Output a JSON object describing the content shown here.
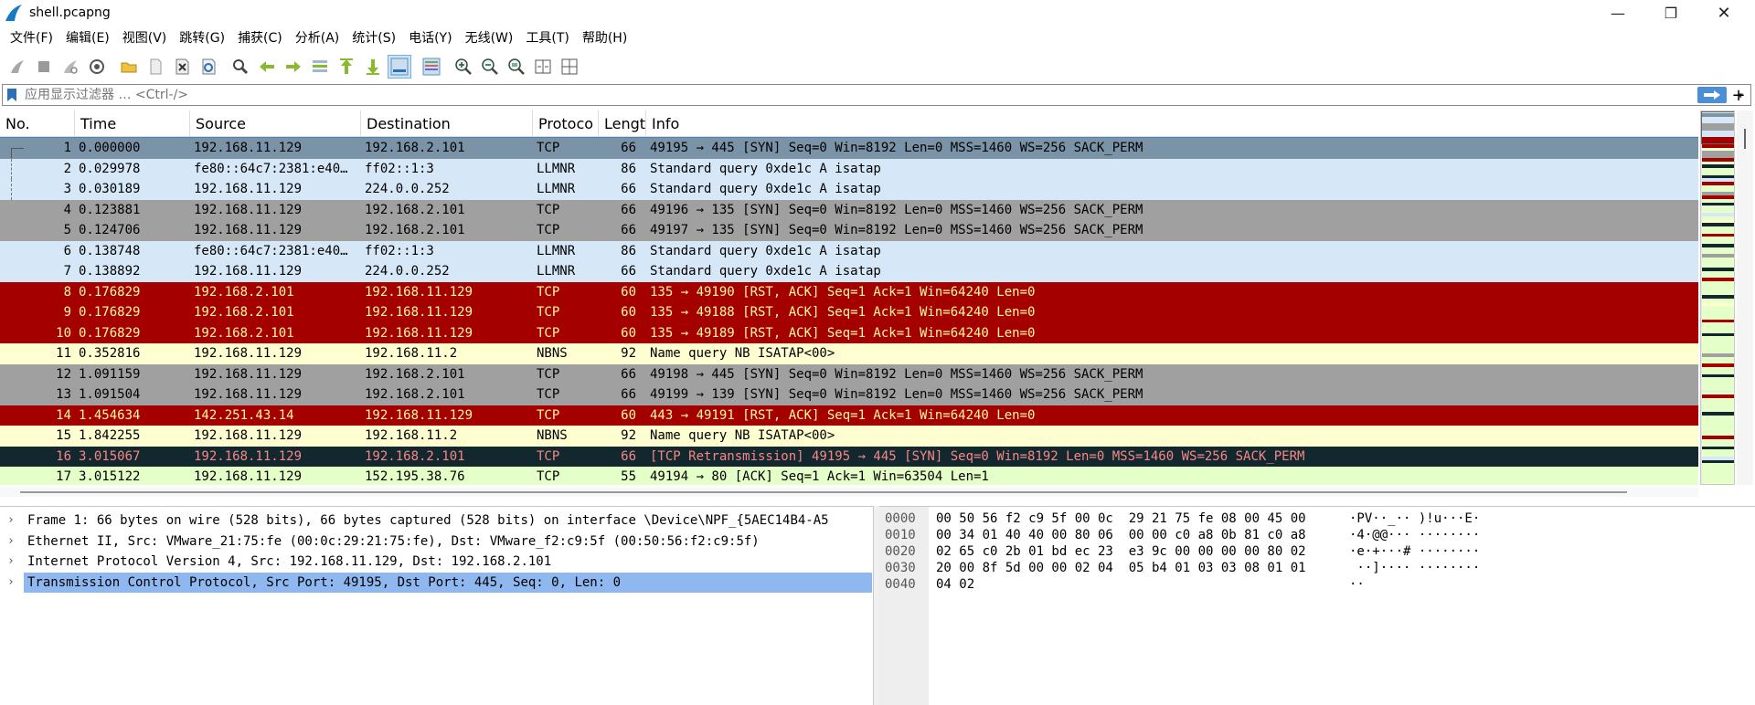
{
  "window": {
    "title": "shell.pcapng",
    "min_glyph": "—",
    "max_glyph": "❐",
    "close_glyph": "✕"
  },
  "menu": [
    "文件(F)",
    "编辑(E)",
    "视图(V)",
    "跳转(G)",
    "捕获(C)",
    "分析(A)",
    "统计(S)",
    "电话(Y)",
    "无线(W)",
    "工具(T)",
    "帮助(H)"
  ],
  "filter": {
    "placeholder": "应用显示过滤器 … <Ctrl-/>",
    "add_glyph": "+",
    "dropdown_glyph": "▾"
  },
  "columns": {
    "no": "No.",
    "time": "Time",
    "source": "Source",
    "destination": "Destination",
    "protocol": "Protoco",
    "length": "Lengt",
    "info": "Info"
  },
  "colors": {
    "selected_bg": "#7b93a7",
    "selected_fg": "#000000",
    "llmnr_bg": "#d6e8f8",
    "tcp_gray_bg": "#a0a0a0",
    "rst_bg": "#a40000",
    "rst_fg": "#fffc9c",
    "nbns_bg": "#fefed0",
    "retrans_bg": "#12272e",
    "retrans_fg": "#f78787",
    "ack_bg": "#e4ffc7",
    "accent": "#4a90d9"
  },
  "packets": [
    {
      "no": "1",
      "time": "0.000000",
      "source": "192.168.11.129",
      "destination": "192.168.2.101",
      "protocol": "TCP",
      "length": "66",
      "info": "49195 → 445 [SYN] Seq=0 Win=8192 Len=0 MSS=1460 WS=256 SACK_PERM",
      "style": "selected"
    },
    {
      "no": "2",
      "time": "0.029978",
      "source": "fe80::64c7:2381:e40…",
      "destination": "ff02::1:3",
      "protocol": "LLMNR",
      "length": "86",
      "info": "Standard query 0xde1c A isatap",
      "style": "llmnr"
    },
    {
      "no": "3",
      "time": "0.030189",
      "source": "192.168.11.129",
      "destination": "224.0.0.252",
      "protocol": "LLMNR",
      "length": "66",
      "info": "Standard query 0xde1c A isatap",
      "style": "llmnr"
    },
    {
      "no": "4",
      "time": "0.123881",
      "source": "192.168.11.129",
      "destination": "192.168.2.101",
      "protocol": "TCP",
      "length": "66",
      "info": "49196 → 135 [SYN] Seq=0 Win=8192 Len=0 MSS=1460 WS=256 SACK_PERM",
      "style": "tcpgray"
    },
    {
      "no": "5",
      "time": "0.124706",
      "source": "192.168.11.129",
      "destination": "192.168.2.101",
      "protocol": "TCP",
      "length": "66",
      "info": "49197 → 135 [SYN] Seq=0 Win=8192 Len=0 MSS=1460 WS=256 SACK_PERM",
      "style": "tcpgray"
    },
    {
      "no": "6",
      "time": "0.138748",
      "source": "fe80::64c7:2381:e40…",
      "destination": "ff02::1:3",
      "protocol": "LLMNR",
      "length": "86",
      "info": "Standard query 0xde1c A isatap",
      "style": "llmnr"
    },
    {
      "no": "7",
      "time": "0.138892",
      "source": "192.168.11.129",
      "destination": "224.0.0.252",
      "protocol": "LLMNR",
      "length": "66",
      "info": "Standard query 0xde1c A isatap",
      "style": "llmnr"
    },
    {
      "no": "8",
      "time": "0.176829",
      "source": "192.168.2.101",
      "destination": "192.168.11.129",
      "protocol": "TCP",
      "length": "60",
      "info": "135 → 49190 [RST, ACK] Seq=1 Ack=1 Win=64240 Len=0",
      "style": "rst"
    },
    {
      "no": "9",
      "time": "0.176829",
      "source": "192.168.2.101",
      "destination": "192.168.11.129",
      "protocol": "TCP",
      "length": "60",
      "info": "135 → 49188 [RST, ACK] Seq=1 Ack=1 Win=64240 Len=0",
      "style": "rst"
    },
    {
      "no": "10",
      "time": "0.176829",
      "source": "192.168.2.101",
      "destination": "192.168.11.129",
      "protocol": "TCP",
      "length": "60",
      "info": "135 → 49189 [RST, ACK] Seq=1 Ack=1 Win=64240 Len=0",
      "style": "rst"
    },
    {
      "no": "11",
      "time": "0.352816",
      "source": "192.168.11.129",
      "destination": "192.168.11.2",
      "protocol": "NBNS",
      "length": "92",
      "info": "Name query NB ISATAP<00>",
      "style": "nbns"
    },
    {
      "no": "12",
      "time": "1.091159",
      "source": "192.168.11.129",
      "destination": "192.168.2.101",
      "protocol": "TCP",
      "length": "66",
      "info": "49198 → 445 [SYN] Seq=0 Win=8192 Len=0 MSS=1460 WS=256 SACK_PERM",
      "style": "tcpgray"
    },
    {
      "no": "13",
      "time": "1.091504",
      "source": "192.168.11.129",
      "destination": "192.168.2.101",
      "protocol": "TCP",
      "length": "66",
      "info": "49199 → 139 [SYN] Seq=0 Win=8192 Len=0 MSS=1460 WS=256 SACK_PERM",
      "style": "tcpgray"
    },
    {
      "no": "14",
      "time": "1.454634",
      "source": "142.251.43.14",
      "destination": "192.168.11.129",
      "protocol": "TCP",
      "length": "60",
      "info": "443 → 49191 [RST, ACK] Seq=1 Ack=1 Win=64240 Len=0",
      "style": "rst"
    },
    {
      "no": "15",
      "time": "1.842255",
      "source": "192.168.11.129",
      "destination": "192.168.11.2",
      "protocol": "NBNS",
      "length": "92",
      "info": "Name query NB ISATAP<00>",
      "style": "nbns"
    },
    {
      "no": "16",
      "time": "3.015067",
      "source": "192.168.11.129",
      "destination": "192.168.2.101",
      "protocol": "TCP",
      "length": "66",
      "info": "[TCP Retransmission] 49195 → 445 [SYN] Seq=0 Win=8192 Len=0 MSS=1460 WS=256 SACK_PERM",
      "style": "retrans"
    },
    {
      "no": "17",
      "time": "3.015122",
      "source": "192.168.11.129",
      "destination": "152.195.38.76",
      "protocol": "TCP",
      "length": "55",
      "info": "49194 → 80 [ACK] Seq=1 Ack=1 Win=63504 Len=1",
      "style": "ack"
    }
  ],
  "details": [
    {
      "text": "Frame 1: 66 bytes on wire (528 bits), 66 bytes captured (528 bits) on interface \\Device\\NPF_{5AEC14B4-A5",
      "selected": false
    },
    {
      "text": "Ethernet II, Src: VMware_21:75:fe (00:0c:29:21:75:fe), Dst: VMware_f2:c9:5f (00:50:56:f2:c9:5f)",
      "selected": false
    },
    {
      "text": "Internet Protocol Version 4, Src: 192.168.11.129, Dst: 192.168.2.101",
      "selected": false
    },
    {
      "text": "Transmission Control Protocol, Src Port: 49195, Dst Port: 445, Seq: 0, Len: 0",
      "selected": true
    }
  ],
  "detail_arrow": "›",
  "hex": [
    {
      "offset": "0000",
      "bytes": "00 50 56 f2 c9 5f 00 0c  29 21 75 fe 08 00 45 00",
      "ascii": "·PV··_·· )!u···E·"
    },
    {
      "offset": "0010",
      "bytes": "00 34 01 40 40 00 80 06  00 00 c0 a8 0b 81 c0 a8",
      "ascii": "·4·@@··· ········"
    },
    {
      "offset": "0020",
      "bytes": "02 65 c0 2b 01 bd ec 23  e3 9c 00 00 00 00 80 02",
      "ascii": "·e·+···# ········"
    },
    {
      "offset": "0030",
      "bytes": "20 00 8f 5d 00 00 02 04  05 b4 01 03 03 08 01 01",
      "ascii": " ··]···· ········"
    },
    {
      "offset": "0040",
      "bytes": "04 02",
      "ascii": "··"
    }
  ],
  "toolbar_icons": [
    "shark-fin-start-icon",
    "stop-icon",
    "restart-icon",
    "capture-options-icon",
    "open-folder-icon",
    "save-file-icon",
    "close-file-icon",
    "reload-icon",
    "find-icon",
    "go-back-icon",
    "go-forward-icon",
    "go-to-packet-icon",
    "first-packet-icon",
    "last-packet-icon",
    "autoscroll-icon",
    "colorize-icon",
    "zoom-in-icon",
    "zoom-out-icon",
    "zoom-normal-icon",
    "resize-columns-icon",
    "layout-icon"
  ]
}
